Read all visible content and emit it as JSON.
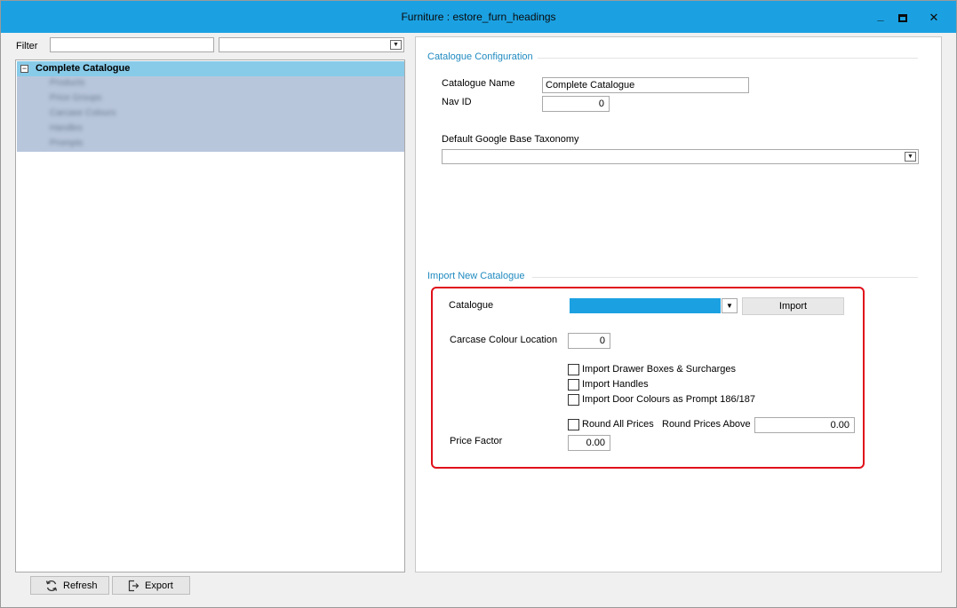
{
  "window": {
    "title": "Furniture : estore_furn_headings",
    "minimize_glyph": "_",
    "maximize_glyph": "□",
    "close_glyph": "✕",
    "titlebar_color": "#1ba1e2"
  },
  "filter": {
    "label": "Filter",
    "text_value": "",
    "combo_value": ""
  },
  "tree": {
    "toggle_glyph": "−",
    "root_label": "Complete Catalogue",
    "children": [
      "Products",
      "Price Groups",
      "Carcase Colours",
      "Handles",
      "Prompts"
    ]
  },
  "config": {
    "section_title": "Catalogue Configuration",
    "catalogue_name_label": "Catalogue Name",
    "catalogue_name_value": "Complete Catalogue",
    "nav_id_label": "Nav ID",
    "nav_id_value": "0",
    "taxonomy_label": "Default Google Base Taxonomy",
    "taxonomy_value": ""
  },
  "import": {
    "section_title": "Import New Catalogue",
    "catalogue_label": "Catalogue",
    "import_button": "Import",
    "carcase_label": "Carcase Colour Location",
    "carcase_value": "0",
    "checkboxes": [
      {
        "label": "Import Drawer Boxes & Surcharges",
        "checked": false
      },
      {
        "label": "Import Handles",
        "checked": false
      },
      {
        "label": "Import Door Colours as Prompt 186/187",
        "checked": false
      }
    ],
    "round_all_label": "Round All Prices",
    "round_above_label": "Round Prices Above",
    "round_above_value": "0.00",
    "price_factor_label": "Price Factor",
    "price_factor_value": "0.00",
    "highlight_color": "#e0101a"
  },
  "footer": {
    "refresh_label": "Refresh",
    "export_label": "Export"
  }
}
